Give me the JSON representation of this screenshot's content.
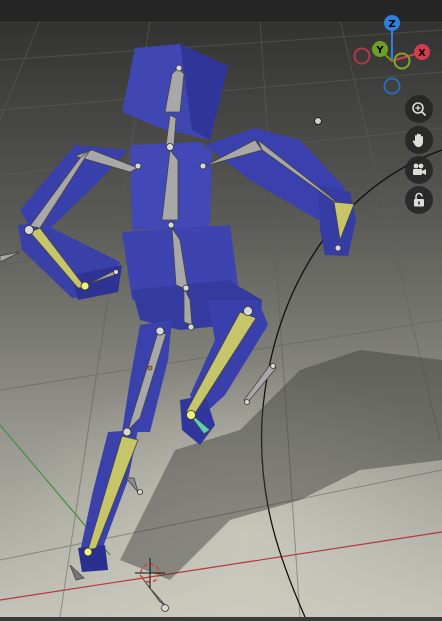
{
  "viewport": {
    "background_top": "#2f2f2f",
    "background_bottom": "#bdbdb4",
    "grid_color": "#565656",
    "x_axis_color": "#b5383f",
    "y_axis_color": "#3f8f3f"
  },
  "gizmo": {
    "z_label": "Z",
    "y_label": "Y",
    "x_label": "X",
    "colors": {
      "z": "#2f7fdc",
      "y": "#6d9e25",
      "x": "#d63b4f",
      "neg_x": "#b4374a",
      "neg_y": "#7fa72a",
      "neg_z": "#2d6ab8"
    }
  },
  "nav_buttons": [
    {
      "name": "zoom-icon"
    },
    {
      "name": "hand-pan-icon"
    },
    {
      "name": "camera-icon"
    },
    {
      "name": "lock-icon"
    }
  ],
  "armature": {
    "mesh_color": "#4046b2",
    "mesh_shadow": "#262a78",
    "bone_color": "#a6a6a6",
    "selected_bone_color": "#c7c66c",
    "joint_color": "#d7d7d7",
    "selected_joint_color": "#f2f27c"
  }
}
